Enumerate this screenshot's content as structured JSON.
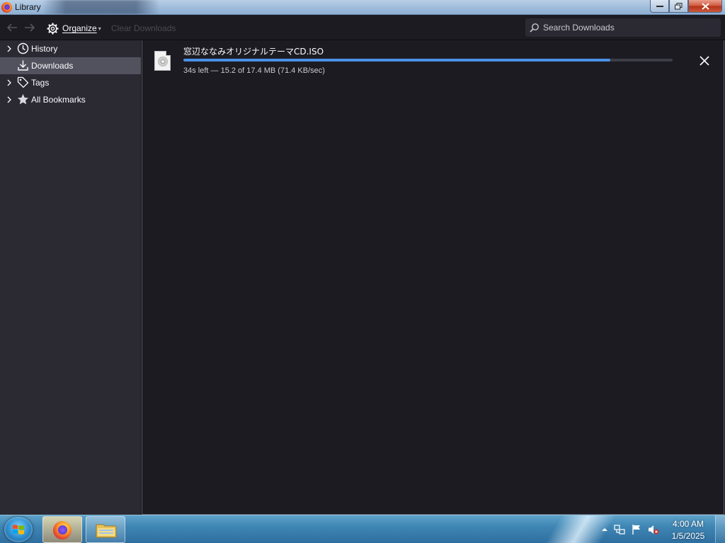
{
  "window": {
    "title": "Library"
  },
  "toolbar": {
    "organize_label": "Organize",
    "clear_label": "Clear Downloads",
    "search_placeholder": "Search Downloads"
  },
  "sidebar": {
    "items": [
      {
        "label": "History",
        "icon": "clock-icon",
        "expandable": true,
        "selected": false
      },
      {
        "label": "Downloads",
        "icon": "download-icon",
        "expandable": false,
        "selected": true
      },
      {
        "label": "Tags",
        "icon": "tag-icon",
        "expandable": true,
        "selected": false
      },
      {
        "label": "All Bookmarks",
        "icon": "star-icon",
        "expandable": true,
        "selected": false
      }
    ]
  },
  "downloads": [
    {
      "filename": "窓辺ななみオリジナルテーマCD.ISO",
      "status": "34s left — 15.2 of 17.4 MB (71.4 KB/sec)",
      "progress": 0.873,
      "icon": "disc-image-file-icon"
    }
  ],
  "taskbar": {
    "apps": [
      "firefox-icon",
      "file-explorer-icon"
    ],
    "tray_icons": [
      "show-hidden-icons-icon",
      "network-icon",
      "action-center-flag-icon",
      "volume-muted-icon"
    ],
    "time": "4:00 AM",
    "date": "1/5/2025"
  },
  "colors": {
    "background": "#1c1b22",
    "sidebar": "#2b2a33",
    "selected_row": "#52525e",
    "progress_accent": "#4b90e6",
    "text_primary": "#fbfbfe",
    "text_secondary": "#c9c9cf"
  }
}
